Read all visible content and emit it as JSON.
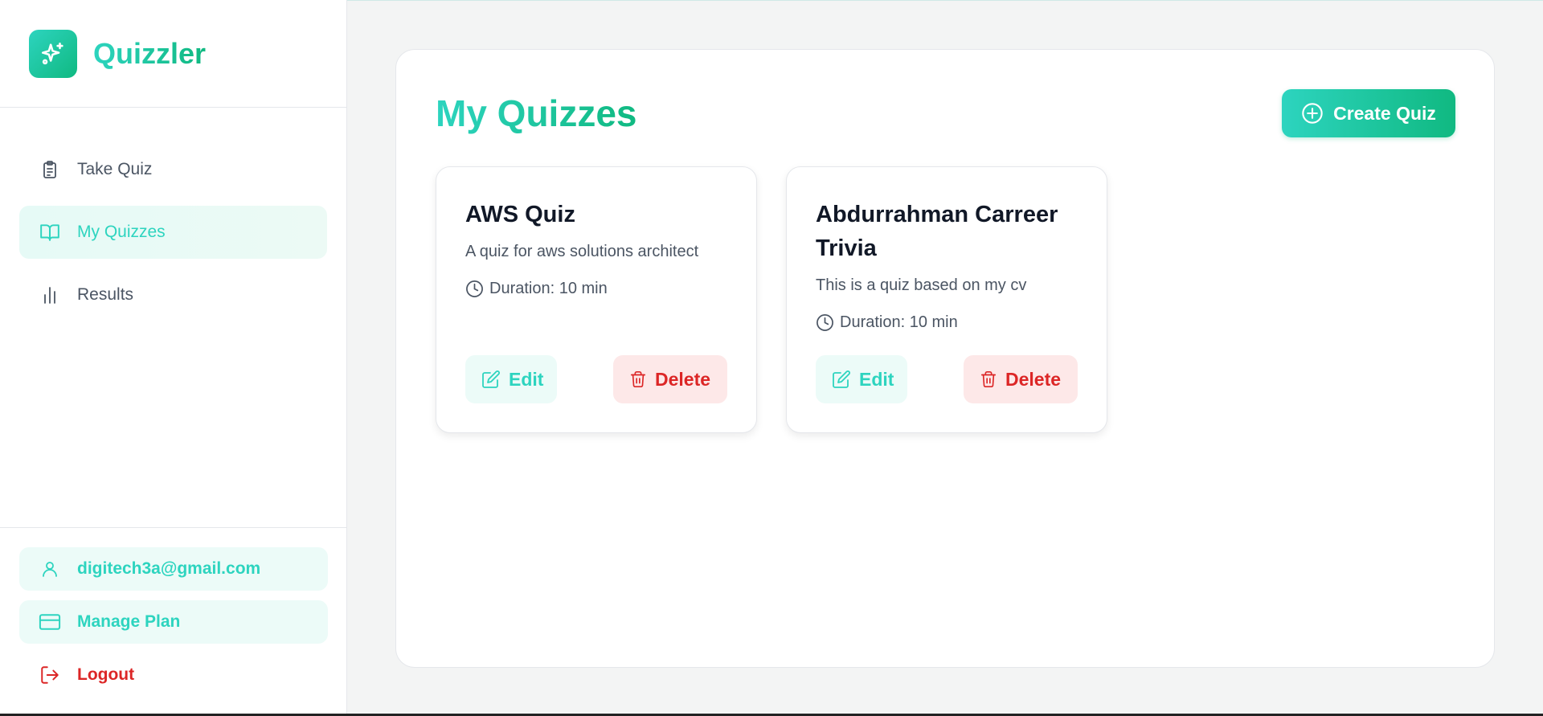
{
  "app": {
    "name": "Quizzler"
  },
  "sidebar": {
    "nav": [
      {
        "label": "Take Quiz",
        "icon": "clipboard-icon",
        "active": false
      },
      {
        "label": "My Quizzes",
        "icon": "book-open-icon",
        "active": true
      },
      {
        "label": "Results",
        "icon": "bar-chart-icon",
        "active": false
      }
    ],
    "account": {
      "email": "digitech3a@gmail.com",
      "manage_plan": "Manage Plan",
      "logout": "Logout"
    }
  },
  "main": {
    "title": "My Quizzes",
    "create_label": "Create Quiz",
    "quizzes": [
      {
        "title": "AWS Quiz",
        "description": "A quiz for aws solutions architect",
        "duration": "Duration: 10 min",
        "edit_label": "Edit",
        "delete_label": "Delete"
      },
      {
        "title": "Abdurrahman Carreer Trivia",
        "description": "This is a quiz based on my cv",
        "duration": "Duration: 10 min",
        "edit_label": "Edit",
        "delete_label": "Delete"
      }
    ]
  },
  "colors": {
    "accent": "#2dd4bf",
    "accent_end": "#10b981",
    "danger": "#dc2626",
    "muted_text": "#4b5563"
  }
}
